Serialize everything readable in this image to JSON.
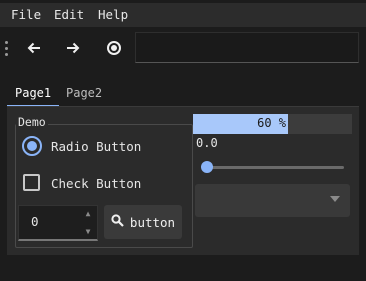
{
  "menubar": {
    "items": [
      {
        "label": "File"
      },
      {
        "label": "Edit"
      },
      {
        "label": "Help"
      }
    ]
  },
  "toolbar": {
    "icons": [
      "grip-icon",
      "arrow-left-icon",
      "arrow-right-icon",
      "radio-record-icon"
    ],
    "address_value": ""
  },
  "tabs": [
    {
      "label": "Page1",
      "active": true
    },
    {
      "label": "Page2",
      "active": false
    }
  ],
  "demo": {
    "title": "Demo",
    "radio": {
      "label": "Radio Button",
      "checked": true
    },
    "checkbox": {
      "label": "Check Button",
      "checked": false
    },
    "spinbox": {
      "value": "0"
    },
    "button": {
      "label": "button",
      "icon": "search-icon"
    }
  },
  "progress": {
    "value": 0.6,
    "text": "60 %"
  },
  "slider": {
    "value_text": "0.0",
    "value": 0.0
  },
  "combo": {
    "selected": ""
  },
  "colors": {
    "accent": "#8ab4f8",
    "background": "#1c1c1c",
    "panel": "#2b2b2b"
  }
}
